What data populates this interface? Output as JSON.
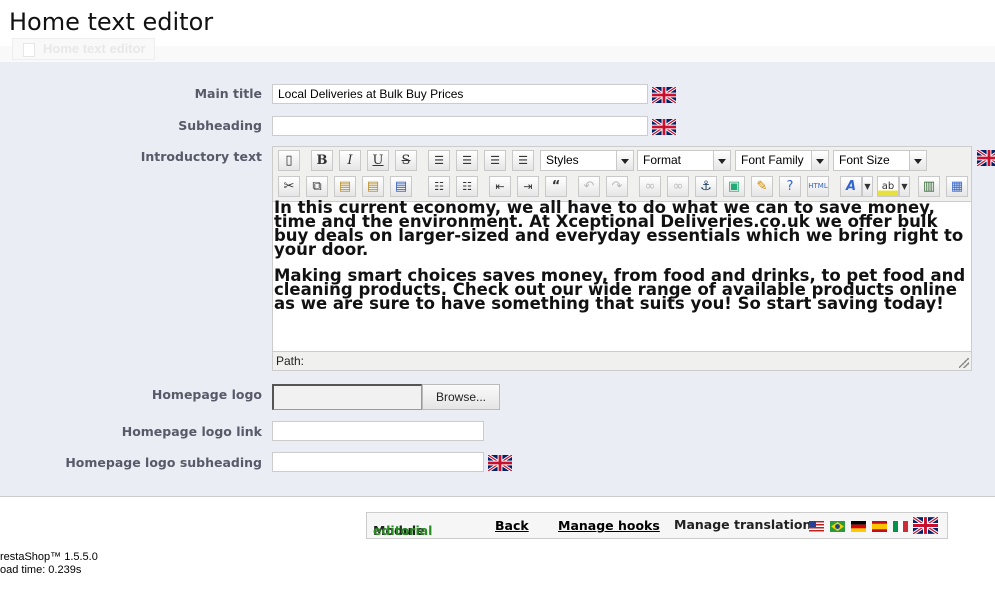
{
  "page": {
    "title": "Home text editor",
    "breadcrumb": "Home text editor"
  },
  "form": {
    "main_title_label": "Main title",
    "main_title_value": "Local Deliveries at Bulk Buy Prices",
    "subheading_label": "Subheading",
    "subheading_value": "",
    "intro_label": "Introductory text",
    "logo_label": "Homepage logo",
    "logo_link_label": "Homepage logo link",
    "logo_link_value": "",
    "logo_subheading_label": "Homepage logo subheading",
    "logo_subheading_value": "",
    "browse_label": "Browse..."
  },
  "editor": {
    "styles": "Styles",
    "format": "Format",
    "font_family": "Font Family",
    "font_size": "Font Size",
    "paragraph1": "In this current economy, we all have to do what we can to save money, time and the environment. At Xceptional Deliveries.co.uk we offer bulk buy deals on larger-sized and everyday essentials which we bring right to your door.",
    "paragraph2": "Making smart choices saves money, from food and drinks, to pet food and cleaning products.  Check out our wide range of available products online as we are sure to have something that suits you! So start saving today!",
    "path_label": "Path:"
  },
  "footer": {
    "module_label": "Module",
    "module_name": "editorial",
    "back": "Back",
    "manage_hooks": "Manage hooks",
    "manage_translations": "Manage translations"
  },
  "meta": {
    "version": "restaShop™ 1.5.5.0",
    "load_time": "oad time: 0.239s"
  },
  "colors": {
    "panel_bg": "#ebedf4",
    "label": "#585a69",
    "module_green": "#268c20"
  }
}
